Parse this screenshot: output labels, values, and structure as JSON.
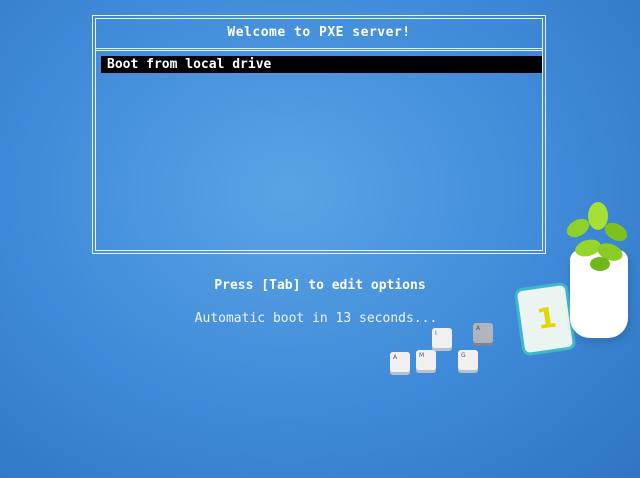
{
  "menu": {
    "title": "Welcome to PXE server!",
    "items": [
      {
        "label": "Boot from local drive",
        "selected": true
      }
    ]
  },
  "hints": {
    "edit_options": "Press [Tab] to edit options",
    "autoboot": "Automatic boot in 13 seconds..."
  },
  "decor": {
    "calendar_digit": "1",
    "keys": [
      "A",
      "M",
      "I",
      "A",
      "G"
    ]
  }
}
